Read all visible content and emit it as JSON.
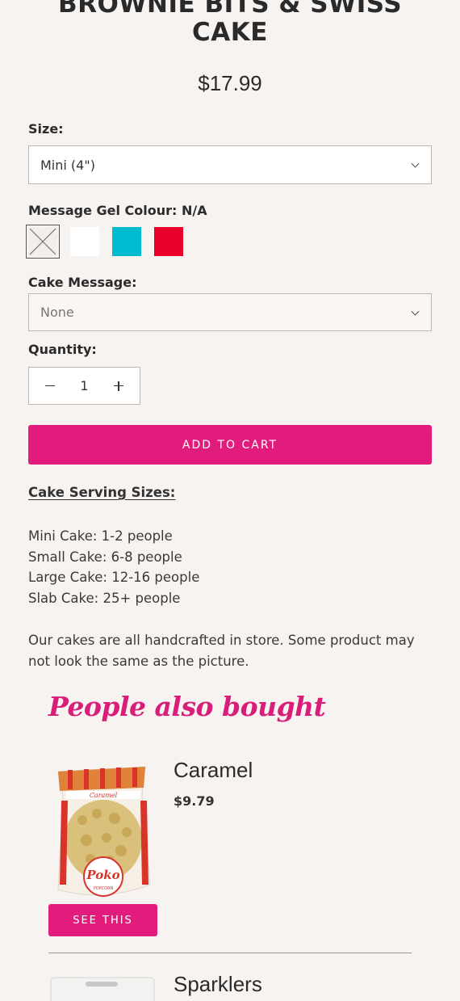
{
  "product": {
    "title_line1": "BROWNIE BITS & SWISS",
    "title_line2": "CAKE",
    "price": "$17.99"
  },
  "size": {
    "label": "Size:",
    "selected": "Mini (4\")"
  },
  "gel_colour": {
    "label": "Message Gel Colour: N/A",
    "swatches": [
      {
        "name": "N/A",
        "color": "#f2eeec"
      },
      {
        "name": "White",
        "color": "#ffffff"
      },
      {
        "name": "Teal",
        "color": "#00bcd0"
      },
      {
        "name": "Red",
        "color": "#e8002a"
      }
    ]
  },
  "cake_message": {
    "label": "Cake Message:",
    "selected": "None"
  },
  "quantity": {
    "label": "Quantity:",
    "value": "1"
  },
  "cart_button": "ADD TO CART",
  "serving": {
    "title": "Cake Serving Sizes:",
    "lines": [
      "Mini Cake: 1-2 people",
      "Small Cake: 6-8 people",
      "Large Cake: 12-16 people",
      "Slab Cake: 25+ people"
    ]
  },
  "handcrafted_note": "Our cakes are all handcrafted in store. Some product may not look the same as the picture.",
  "also_bought": {
    "heading": "People also bought",
    "items": [
      {
        "name": "Caramel",
        "price": "$9.79",
        "button": "SEE THIS",
        "bag_label": "Caramel",
        "brand": "Poko",
        "brand_sub": "POPCORN"
      },
      {
        "name": "Sparklers"
      }
    ]
  },
  "colors": {
    "accent": "#e21c7d",
    "background": "#f7f3f1"
  }
}
